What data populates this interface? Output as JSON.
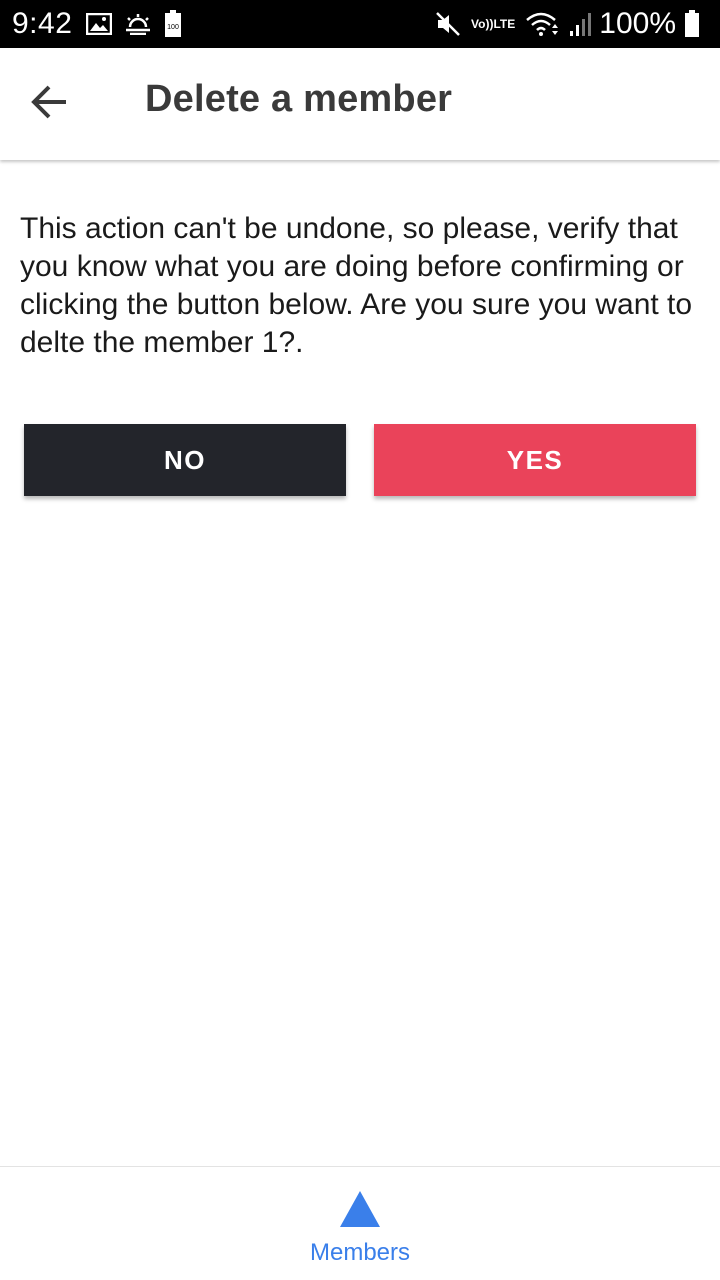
{
  "status_bar": {
    "time": "9:42",
    "battery_percent": "100%",
    "battery_badge": "100",
    "lte_top": "Vo))",
    "lte_bottom": "LTE",
    "left_icons": [
      "image-icon",
      "weather-icon",
      "battery-saver-icon"
    ],
    "right_icons": [
      "mute-icon",
      "volte-icon",
      "wifi-icon",
      "signal-icon",
      "battery-icon"
    ]
  },
  "app_bar": {
    "title": "Delete a member",
    "back_icon": "arrow-back-icon"
  },
  "content": {
    "message": "This action can't be undone, so please, verify that you know what you are doing before confirming or clicking the button below. Are you sure you want to delte the member 1?."
  },
  "buttons": {
    "no_label": "NO",
    "yes_label": "YES",
    "no_color": "#23252b",
    "yes_color": "#ea435a"
  },
  "bottom_nav": {
    "items": [
      {
        "label": "Members",
        "icon": "triangle-icon",
        "active": true
      }
    ],
    "active_color": "#3a7fea"
  }
}
